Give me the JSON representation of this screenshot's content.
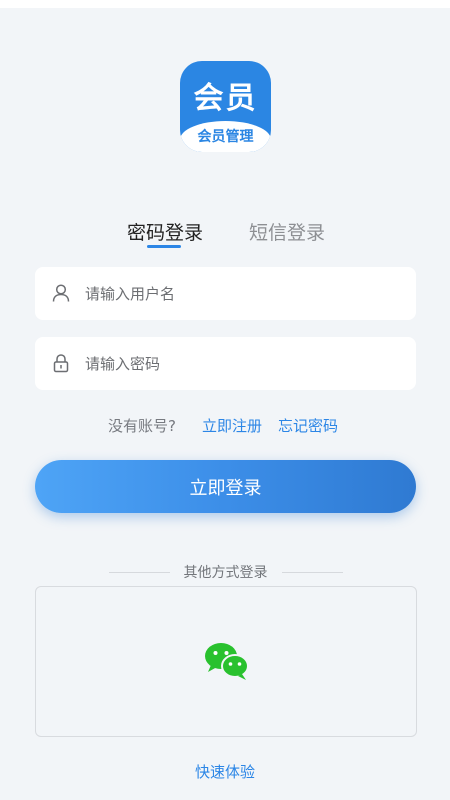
{
  "logo": {
    "main_text": "会员",
    "sub_text": "会员管理"
  },
  "tabs": [
    {
      "label": "密码登录",
      "active": true
    },
    {
      "label": "短信登录",
      "active": false
    }
  ],
  "form": {
    "username_placeholder": "请输入用户名",
    "password_placeholder": "请输入密码"
  },
  "links": {
    "no_account": "没有账号?",
    "register": "立即注册",
    "forgot_password": "忘记密码"
  },
  "login_button": "立即登录",
  "other_login": {
    "label": "其他方式登录",
    "icons": [
      "wechat-icon"
    ]
  },
  "quick_experience": "快速体验",
  "colors": {
    "accent": "#2c86e6",
    "background": "#f2f5f8",
    "wechat": "#29c12e"
  }
}
